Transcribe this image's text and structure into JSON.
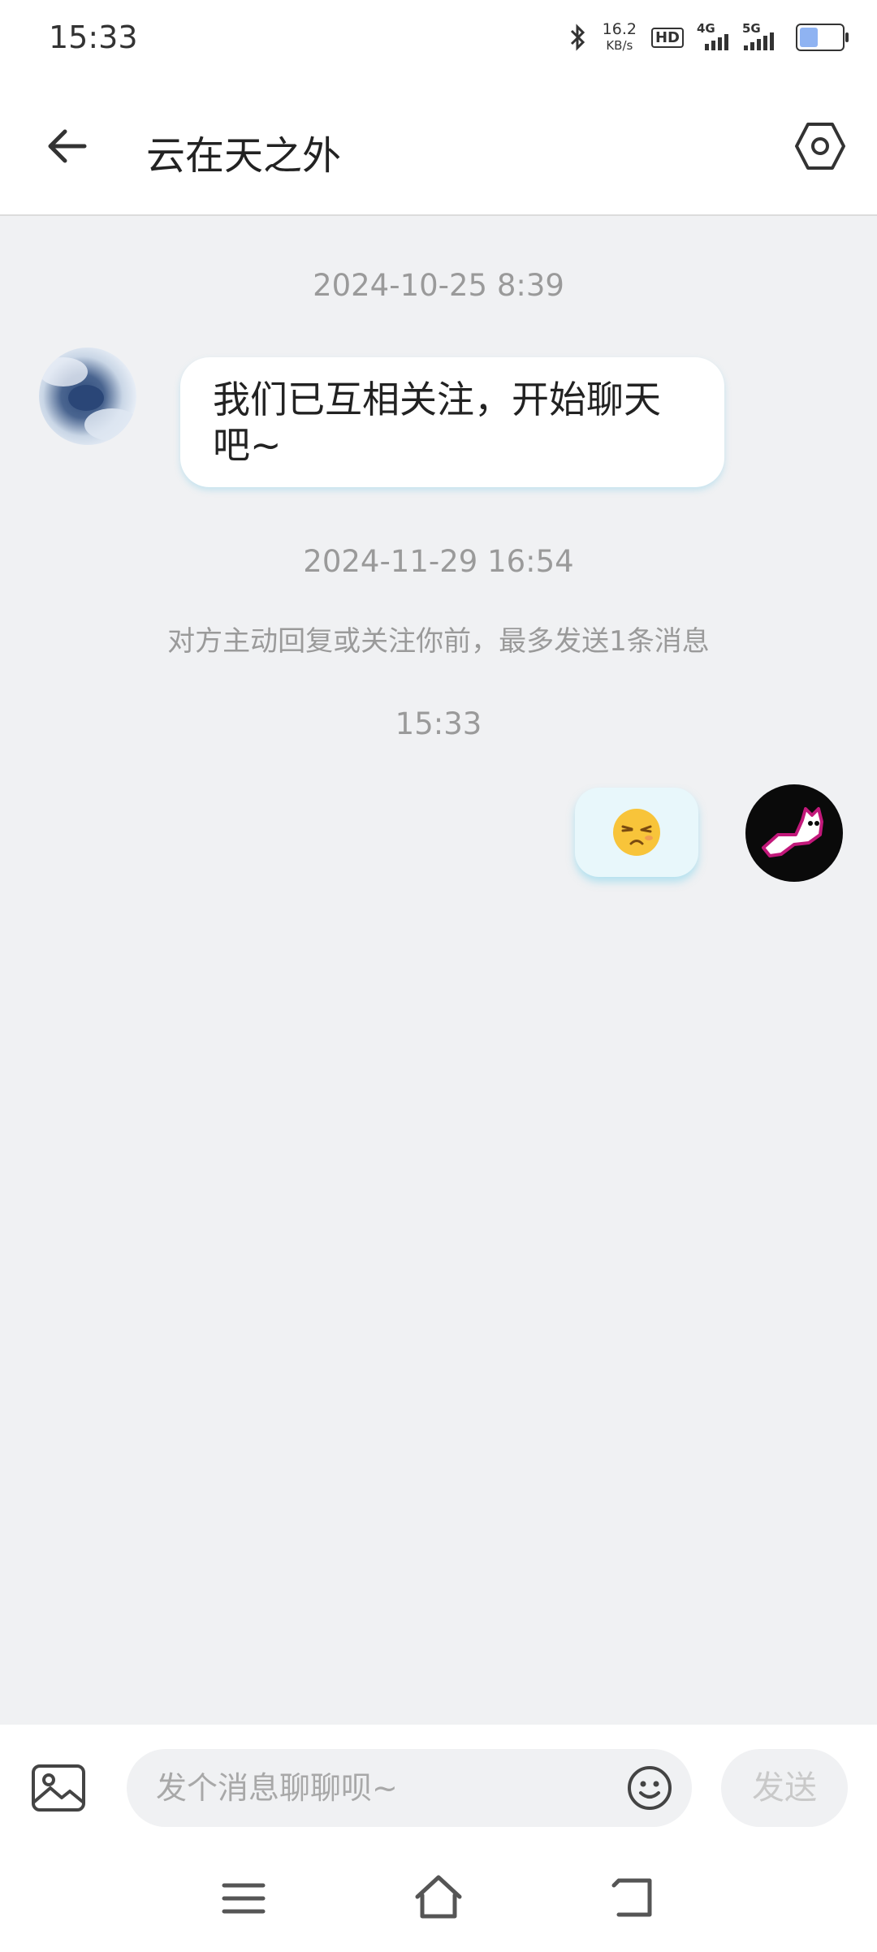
{
  "status_bar": {
    "time": "15:33",
    "net_speed_value": "16.2",
    "net_speed_unit": "KB/s",
    "hd_label": "HD",
    "signal_1_label": "4G",
    "signal_2_label": "5G",
    "icons": [
      "bluetooth-icon",
      "hd-icon",
      "signal-4g-icon",
      "signal-5g-icon",
      "battery-icon"
    ]
  },
  "header": {
    "title": "云在天之外",
    "back_icon": "back-arrow-icon",
    "settings_icon": "settings-hex-icon"
  },
  "chat": {
    "items": [
      {
        "type": "timestamp",
        "text": "2024-10-25 8:39"
      },
      {
        "type": "message",
        "side": "left",
        "text": "我们已互相关注，开始聊天吧~"
      },
      {
        "type": "timestamp",
        "text": "2024-11-29 16:54"
      },
      {
        "type": "notice",
        "text": "对方主动回复或关注你前，最多发送1条消息"
      },
      {
        "type": "timestamp",
        "text": "15:33"
      },
      {
        "type": "message",
        "side": "right",
        "emoji": "annoyed-face-emoji"
      }
    ]
  },
  "input_bar": {
    "image_icon": "image-icon",
    "placeholder": "发个消息聊聊呗~",
    "emoji_icon": "emoji-icon",
    "send_label": "发送"
  },
  "nav_bar": {
    "icons": [
      "menu-icon",
      "home-icon",
      "back-icon"
    ]
  },
  "colors": {
    "background": "#f0f1f3",
    "bubble_shadow": "#8fd3ea",
    "muted_text": "#9a9a9a"
  }
}
